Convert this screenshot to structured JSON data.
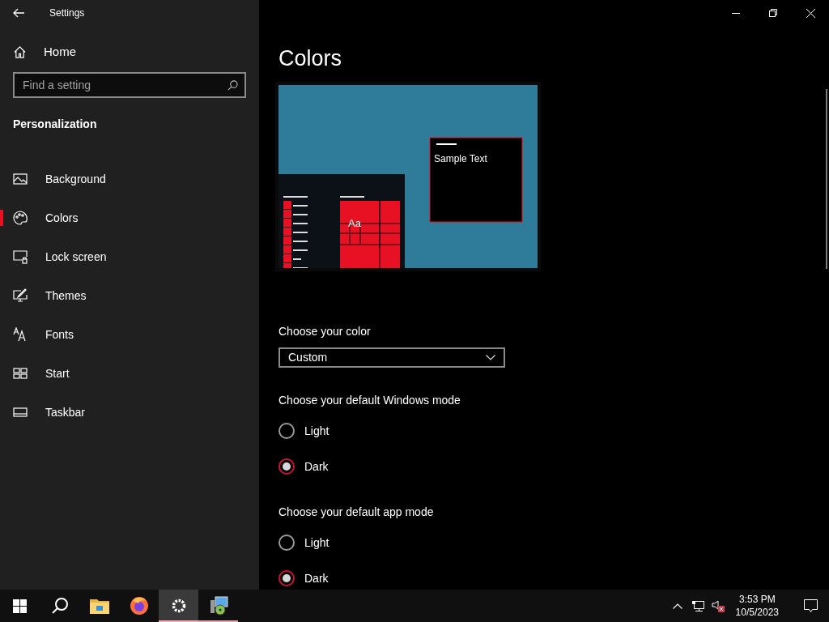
{
  "window": {
    "title": "Settings"
  },
  "sidebar": {
    "home": "Home",
    "search": {
      "placeholder": "Find a setting"
    },
    "section": "Personalization",
    "items": [
      {
        "label": "Background",
        "selected": false
      },
      {
        "label": "Colors",
        "selected": true
      },
      {
        "label": "Lock screen",
        "selected": false
      },
      {
        "label": "Themes",
        "selected": false
      },
      {
        "label": "Fonts",
        "selected": false
      },
      {
        "label": "Start",
        "selected": false
      },
      {
        "label": "Taskbar",
        "selected": false
      }
    ]
  },
  "page": {
    "title": "Colors",
    "preview": {
      "tile_text": "Aa",
      "sample_text": "Sample Text"
    },
    "color_choice": {
      "label": "Choose your color",
      "value": "Custom"
    },
    "groups": [
      {
        "label": "Choose your default Windows mode",
        "options": [
          {
            "label": "Light",
            "selected": false
          },
          {
            "label": "Dark",
            "selected": true
          }
        ]
      },
      {
        "label": "Choose your default app mode",
        "options": [
          {
            "label": "Light",
            "selected": false
          },
          {
            "label": "Dark",
            "selected": true
          }
        ]
      }
    ]
  },
  "taskbar": {
    "apps": [
      {
        "selected": false,
        "running": false
      },
      {
        "selected": false,
        "running": false
      },
      {
        "selected": false,
        "running": false
      },
      {
        "selected": false,
        "running": false
      },
      {
        "selected": true,
        "running": true
      },
      {
        "selected": false,
        "running": true
      }
    ],
    "time": "3:53 PM",
    "date": "10/5/2023"
  }
}
